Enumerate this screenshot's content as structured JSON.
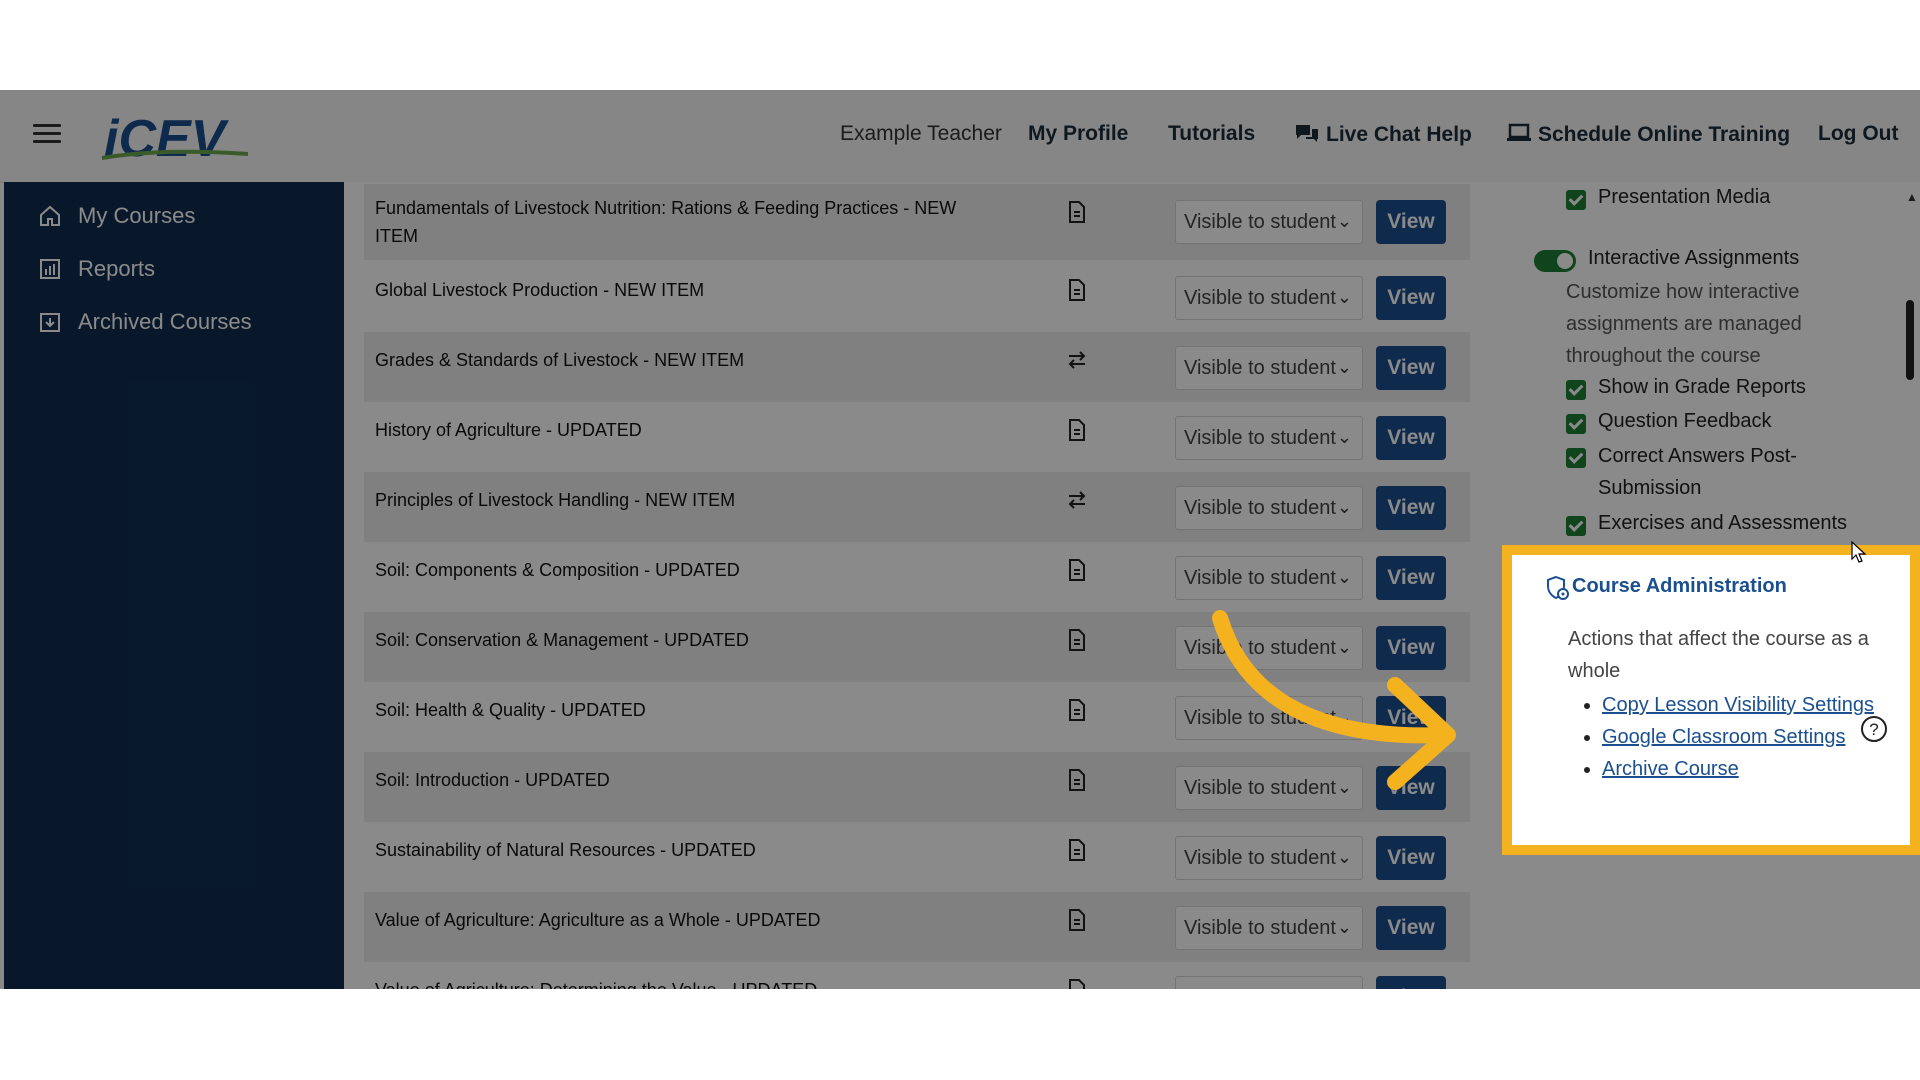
{
  "header": {
    "user_name": "Example Teacher",
    "my_profile": "My Profile",
    "tutorials": "Tutorials",
    "live_chat": "Live Chat Help",
    "schedule_training": "Schedule Online Training",
    "log_out": "Log Out",
    "logo_text": "iCEV"
  },
  "sidebar": {
    "items": [
      {
        "label": "My Courses",
        "icon": "home-icon"
      },
      {
        "label": "Reports",
        "icon": "chart-icon"
      },
      {
        "label": "Archived Courses",
        "icon": "archive-icon"
      }
    ]
  },
  "lessons": {
    "select_value": "Visible to student",
    "view_label": "View",
    "rows": [
      {
        "title": "Fundamentals of Livestock Nutrition: Rations & Feeding Practices - NEW ITEM",
        "icon": "document-icon"
      },
      {
        "title": "Global Livestock Production - NEW ITEM",
        "icon": "document-icon"
      },
      {
        "title": "Grades & Standards of Livestock - NEW ITEM",
        "icon": "swap-icon"
      },
      {
        "title": "History of Agriculture - UPDATED",
        "icon": "document-icon"
      },
      {
        "title": "Principles of Livestock Handling - NEW ITEM",
        "icon": "swap-icon"
      },
      {
        "title": "Soil: Components & Composition - UPDATED",
        "icon": "document-icon"
      },
      {
        "title": "Soil: Conservation & Management - UPDATED",
        "icon": "document-icon"
      },
      {
        "title": "Soil: Health & Quality - UPDATED",
        "icon": "document-icon"
      },
      {
        "title": "Soil: Introduction - UPDATED",
        "icon": "document-icon"
      },
      {
        "title": "Sustainability of Natural Resources - UPDATED",
        "icon": "document-icon"
      },
      {
        "title": "Value of Agriculture: Agriculture as a Whole - UPDATED",
        "icon": "document-icon"
      },
      {
        "title": "Value of Agriculture: Determining the Value - UPDATED",
        "icon": "document-icon"
      }
    ]
  },
  "settings": {
    "presentation_media": "Presentation Media",
    "interactive_assignments": "Interactive Assignments",
    "interactive_desc": "Customize how interactive assignments are managed throughout the course",
    "show_grade_reports": "Show in Grade Reports",
    "question_feedback": "Question Feedback",
    "correct_answers": "Correct Answers Post-Submission",
    "exercises": "Exercises and Assessments"
  },
  "admin": {
    "title": "Course Administration",
    "description": "Actions that affect the course as a whole",
    "links": [
      "Copy Lesson Visibility Settings",
      "Google Classroom Settings",
      "Archive Course"
    ]
  },
  "colors": {
    "sidebar": "#0f2e4f",
    "primary": "#1b4f8f",
    "highlight": "#f5b21f",
    "check": "#1e7e34"
  }
}
